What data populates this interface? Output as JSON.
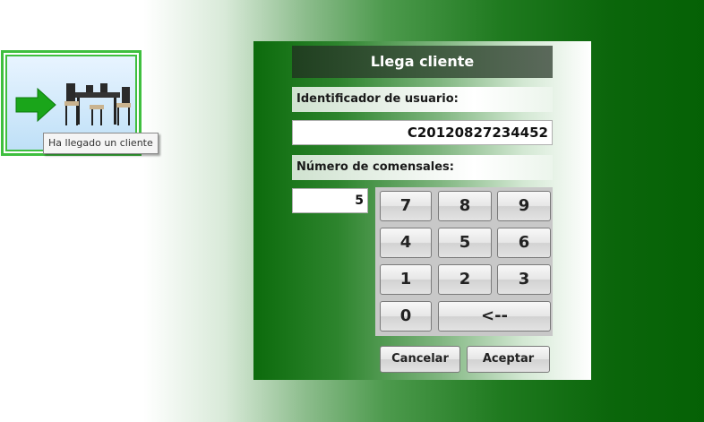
{
  "tile": {
    "icon": "customer-arrival-icon",
    "tooltip": "Ha llegado un cliente"
  },
  "dialog": {
    "title": "Llega cliente",
    "user_id_label": "Identificador de usuario:",
    "user_id_value": "C20120827234452",
    "diners_label": "Número de comensales:",
    "diners_value": "5",
    "keys": {
      "k7": "7",
      "k8": "8",
      "k9": "9",
      "k4": "4",
      "k5": "5",
      "k6": "6",
      "k1": "1",
      "k2": "2",
      "k3": "3",
      "k0": "0",
      "backspace": "<--"
    },
    "cancel_label": "Cancelar",
    "accept_label": "Aceptar"
  },
  "colors": {
    "accent_green": "#056105",
    "tile_border": "#3fbf3f"
  }
}
